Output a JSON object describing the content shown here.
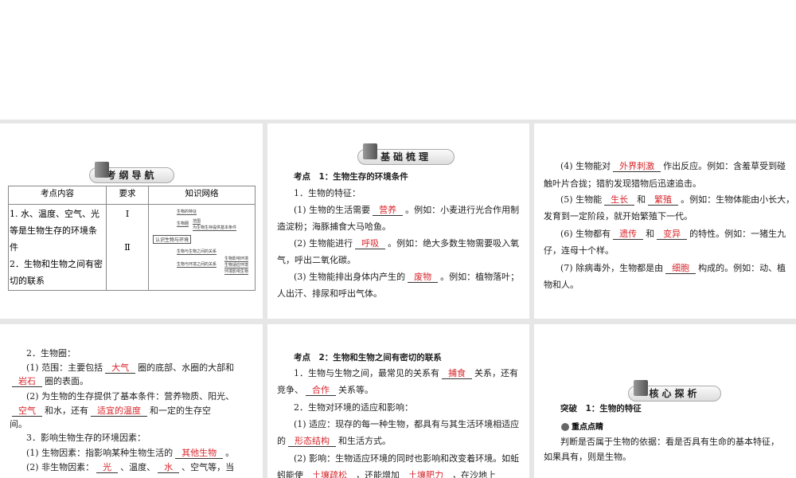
{
  "banners": {
    "outline": "考纲导航",
    "basics": "基础梳理",
    "core": "核心探析"
  },
  "table": {
    "headers": [
      "考点内容",
      "要求",
      "知识网络"
    ],
    "rows": [
      {
        "content": "1. 水、温度、空气、光等是生物生存的环境条件",
        "level": "Ⅰ"
      },
      {
        "content": "2．生物和生物之间有密切的联系",
        "level": "Ⅱ"
      }
    ],
    "mindmap": {
      "root": "认识生物与环境",
      "nodes": [
        "生物的特征",
        "生物圈",
        "范围",
        "为生物生存提供基本条件",
        "生物与生物之间的关系",
        "生物与环境之间的关系",
        "生物影响环境",
        "生物适应环境",
        "环境影响生物"
      ]
    }
  },
  "panels": [
    {
      "lines": []
    },
    {
      "lines": [
        [
          {
            "t": "考点　1：生物生存的环境条件"
          }
        ],
        [
          {
            "t": "1．生物的特征："
          }
        ],
        [
          {
            "t": "(1) 生物的生活需要"
          },
          {
            "b": "营养"
          },
          {
            "t": "。例如：小麦进行光合作用制"
          }
        ],
        [
          {
            "t": "造淀粉；海豚捕食大马哈鱼。"
          }
        ],
        [
          {
            "t": "(2) 生物能进行"
          },
          {
            "b": "呼吸"
          },
          {
            "t": "。例如：绝大多数生物需要吸入氧"
          }
        ],
        [
          {
            "t": "气，呼出二氧化碳。"
          }
        ],
        [
          {
            "t": "(3) 生物能排出身体内产生的"
          },
          {
            "b": "废物"
          },
          {
            "t": "。例如：植物落叶；"
          }
        ],
        [
          {
            "t": "人出汗、排尿和呼出气体。"
          }
        ]
      ]
    },
    {
      "lines": [
        [
          {
            "t": "(4) 生物能对"
          },
          {
            "b": "外界刺激"
          },
          {
            "t": "作出反应。例如：含羞草受到碰"
          }
        ],
        [
          {
            "t": "触叶片合拢；猎豹发现猎物后迅速追击。"
          }
        ],
        [
          {
            "t": "(5) 生物能"
          },
          {
            "b": "生长"
          },
          {
            "t": "和"
          },
          {
            "b": "繁殖"
          },
          {
            "t": "。例如：生物体能由小长大，"
          }
        ],
        [
          {
            "t": "发育到一定阶段，就开始繁殖下一代。"
          }
        ],
        [
          {
            "t": "(6) 生物都有"
          },
          {
            "b": "遗传"
          },
          {
            "t": "和"
          },
          {
            "b": "变异"
          },
          {
            "t": "的特性。例如：一猪生九"
          }
        ],
        [
          {
            "t": "仔，连母十个样。"
          }
        ],
        [
          {
            "t": "(7) 除病毒外，生物都是由"
          },
          {
            "b": "细胞"
          },
          {
            "t": "构成的。例如：动、植"
          }
        ],
        [
          {
            "t": "物和人。"
          }
        ]
      ]
    },
    {
      "lines": [
        [
          {
            "t": "2．生物圈："
          }
        ],
        [
          {
            "t": "(1) 范围：主要包括"
          },
          {
            "b": "大气"
          },
          {
            "t": "圈的底部、水圈的大部和"
          }
        ],
        [
          {
            "b": "岩石"
          },
          {
            "t": "圈的表面。"
          }
        ],
        [
          {
            "t": "(2) 为生物的生存提供了基本条件：营养物质、阳光、"
          }
        ],
        [
          {
            "b": "空气"
          },
          {
            "t": "和水，还有"
          },
          {
            "b": "适宜的温度"
          },
          {
            "t": "和一定的生存空"
          }
        ],
        [
          {
            "t": "间。"
          }
        ],
        [
          {
            "t": "3．影响生物生存的环境因素："
          }
        ],
        [
          {
            "t": "(1) 生物因素：指影响某种生物生活的"
          },
          {
            "b": "其他生物"
          },
          {
            "t": "。"
          }
        ],
        [
          {
            "t": "(2) 非生物因素："
          },
          {
            "b": "光"
          },
          {
            "t": "、温度、"
          },
          {
            "b": "水"
          },
          {
            "t": "、空气等，当"
          }
        ]
      ]
    },
    {
      "lines": [
        [
          {
            "t": "考点　2：生物和生物之间有密切的联系"
          }
        ],
        [
          {
            "t": "1．生物与生物之间，最常见的关系有"
          },
          {
            "b": "捕食"
          },
          {
            "t": "关系，还有"
          }
        ],
        [
          {
            "t": "竞争、"
          },
          {
            "b": "合作"
          },
          {
            "t": "关系等。"
          }
        ],
        [
          {
            "t": "2．生物对环境的适应和影响："
          }
        ],
        [
          {
            "t": "(1) 适应：现存的每一种生物，都具有与其生活环境相适应"
          }
        ],
        [
          {
            "t": "的"
          },
          {
            "b": "形态结构"
          },
          {
            "t": "和生活方式。"
          }
        ],
        [
          {
            "t": "(2) 影响：生物适应环境的同时也影响和改变着环境。如蚯"
          }
        ],
        [
          {
            "t": "蚓能使"
          },
          {
            "b": "土壤疏松"
          },
          {
            "t": "，还能增加"
          },
          {
            "b": "土壤肥力"
          },
          {
            "t": "，在沙地上"
          }
        ]
      ]
    },
    {
      "lines": [
        [
          {
            "t": "突破　1：生物的特征"
          }
        ],
        [
          {
            "t": "判断是否属于生物的依据：看是否具有生命的基本特征，"
          }
        ],
        [
          {
            "t": "如果具有，则是生物。"
          }
        ]
      ],
      "tag": "重点点睛"
    }
  ]
}
